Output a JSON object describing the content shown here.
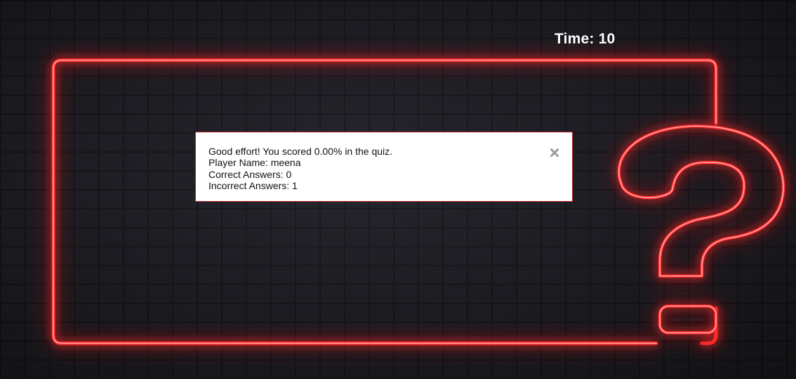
{
  "timer": {
    "label": "Time: 10"
  },
  "result_modal": {
    "message": "Good effort! You scored 0.00% in the quiz.",
    "player": "Player Name: meena",
    "correct": "Correct Answers: 0",
    "incorrect": "Incorrect Answers: 1",
    "close_icon": "close-icon"
  },
  "colors": {
    "neon": "#ff2a2a",
    "modal_border": "#c0272d",
    "wall": "#202026"
  }
}
